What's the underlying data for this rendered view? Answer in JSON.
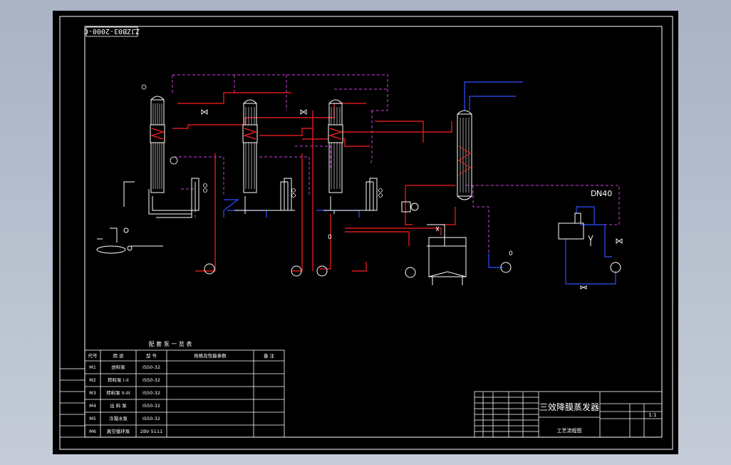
{
  "drawing_number": "ZJZB03-2000-C",
  "labels": {
    "dn": "D",
    "dn_value": "N40",
    "pump_mark": "0",
    "valve_mark": "0"
  },
  "equipment_table": {
    "caption": "配 套 泵 一 览 表",
    "headers": [
      "代号",
      "用 途",
      "型 号",
      "规格及性能参数",
      "备 注"
    ],
    "rows": [
      [
        "M1",
        "进料泵",
        "IS50-32",
        "",
        ""
      ],
      [
        "M2",
        "转料泵 I-II",
        "IS50-32",
        "",
        ""
      ],
      [
        "M3",
        "转料泵 II-III",
        "IS50-32",
        "",
        ""
      ],
      [
        "M4",
        "出 料 泵",
        "IS50-32",
        "",
        ""
      ],
      [
        "M5",
        "冷凝水泵",
        "IS50-32",
        "",
        ""
      ],
      [
        "M6",
        "真空循环泵",
        "2BV 5111",
        "",
        ""
      ]
    ]
  },
  "left_strip": [
    "",
    "",
    "",
    "",
    "",
    ""
  ],
  "title_block": {
    "title": "三效降膜蒸发器",
    "subtitle": "工艺流程图",
    "scale": "1:1"
  },
  "colors": {
    "steam": "#ff2020",
    "material": "#ffffff",
    "cooling": "#3050ff",
    "vacuum": "#d040e0",
    "frame": "#ffffff"
  }
}
